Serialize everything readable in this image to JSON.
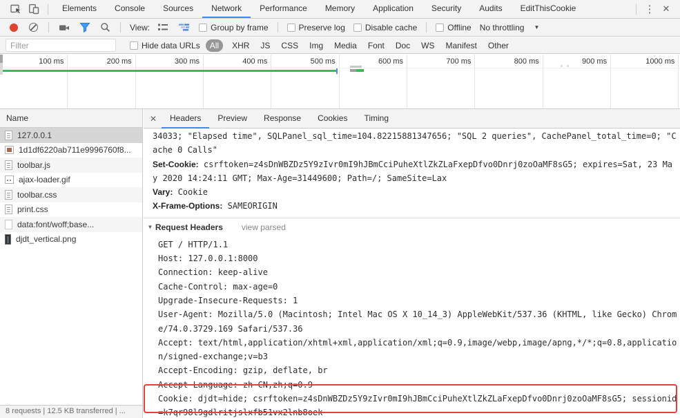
{
  "colors": {
    "accent": "#4285f4",
    "green": "#3cba54",
    "record_red": "#e0432f",
    "filter_blue": "#3f9bf7",
    "highlight_red": "#ee3b3b",
    "selected_row": "#d6d6d6"
  },
  "tabbar": {
    "tabs": [
      {
        "label": "Elements",
        "state": ""
      },
      {
        "label": "Console",
        "state": ""
      },
      {
        "label": "Sources",
        "state": ""
      },
      {
        "label": "Network",
        "state": "active"
      },
      {
        "label": "Performance",
        "state": ""
      },
      {
        "label": "Memory",
        "state": ""
      },
      {
        "label": "Application",
        "state": ""
      },
      {
        "label": "Security",
        "state": ""
      },
      {
        "label": "Audits",
        "state": ""
      },
      {
        "label": "EditThisCookie",
        "state": ""
      }
    ]
  },
  "toolbar": {
    "view_label": "View:",
    "group_by_frame": "Group by frame",
    "preserve_log": "Preserve log",
    "disable_cache": "Disable cache",
    "offline": "Offline",
    "throttling": "No throttling"
  },
  "filter_bar": {
    "placeholder": "Filter",
    "hide_data_urls": "Hide data URLs",
    "types": [
      {
        "label": "All",
        "state": "active"
      },
      {
        "label": "XHR",
        "state": ""
      },
      {
        "label": "JS",
        "state": ""
      },
      {
        "label": "CSS",
        "state": ""
      },
      {
        "label": "Img",
        "state": ""
      },
      {
        "label": "Media",
        "state": ""
      },
      {
        "label": "Font",
        "state": ""
      },
      {
        "label": "Doc",
        "state": ""
      },
      {
        "label": "WS",
        "state": ""
      },
      {
        "label": "Manifest",
        "state": ""
      },
      {
        "label": "Other",
        "state": ""
      }
    ]
  },
  "timeline": {
    "ticks": [
      "100 ms",
      "200 ms",
      "300 ms",
      "400 ms",
      "500 ms",
      "600 ms",
      "700 ms",
      "800 ms",
      "900 ms",
      "1000 ms"
    ]
  },
  "requests_panel": {
    "header": "Name",
    "rows": [
      {
        "label": "127.0.0.1",
        "icon": "icon-doc",
        "state": "selected"
      },
      {
        "label": "1d1df6220ab711e9996760f8...",
        "icon": "icon-img",
        "state": ""
      },
      {
        "label": "toolbar.js",
        "icon": "icon-doc",
        "state": "stripe"
      },
      {
        "label": "ajax-loader.gif",
        "icon": "icon-gif",
        "state": ""
      },
      {
        "label": "toolbar.css",
        "icon": "icon-doc",
        "state": "stripe"
      },
      {
        "label": "print.css",
        "icon": "icon-doc",
        "state": ""
      },
      {
        "label": "data:font/woff;base...",
        "icon": "icon-blank",
        "state": "stripe"
      },
      {
        "label": "djdt_vertical.png",
        "icon": "icon-dark",
        "state": ""
      }
    ],
    "status": "8 requests | 12.5 KB transferred | ..."
  },
  "details_panel": {
    "tabs": [
      {
        "label": "Headers",
        "state": "active"
      },
      {
        "label": "Preview",
        "state": ""
      },
      {
        "label": "Response",
        "state": ""
      },
      {
        "label": "Cookies",
        "state": ""
      },
      {
        "label": "Timing",
        "state": ""
      }
    ],
    "response_headers": [
      {
        "name": "",
        "value": "34033; \"Elapsed time\", SQLPanel_sql_time=104.82215881347656; \"SQL 2 queries\", CachePanel_total_time=0; \"Cache 0 Calls\""
      },
      {
        "name": "Set-Cookie:",
        "value": " csrftoken=z4sDnWBZDz5Y9zIvr0mI9hJBmCciPuheXtlZkZLaFxepDfvo0Dnrj0zoOaMF8sG5; expires=Sat, 23 May 2020 14:24:11 GMT; Max-Age=31449600; Path=/; SameSite=Lax"
      },
      {
        "name": "Vary:",
        "value": " Cookie"
      },
      {
        "name": "X-Frame-Options:",
        "value": " SAMEORIGIN"
      }
    ],
    "request_section": {
      "title": "Request Headers",
      "action": "view parsed",
      "lines": [
        "GET / HTTP/1.1",
        "Host: 127.0.0.1:8000",
        "Connection: keep-alive",
        "Cache-Control: max-age=0",
        "Upgrade-Insecure-Requests: 1",
        "User-Agent: Mozilla/5.0 (Macintosh; Intel Mac OS X 10_14_3) AppleWebKit/537.36 (KHTML, like Gecko) Chrome/74.0.3729.169 Safari/537.36",
        "Accept: text/html,application/xhtml+xml,application/xml;q=0.9,image/webp,image/apng,*/*;q=0.8,application/signed-exchange;v=b3",
        "Accept-Encoding: gzip, deflate, br",
        "Accept-Language: zh-CN,zh;q=0.9",
        "Cookie: djdt=hide; csrftoken=z4sDnWBZDz5Y9zIvr0mI9hJBmCciPuheXtlZkZLaFxepDfvo0Dnrj0zoOaMF8sG5; sessionid=k7qr98l9gdlritjslxfb51vx2lnb8oek"
      ]
    }
  }
}
